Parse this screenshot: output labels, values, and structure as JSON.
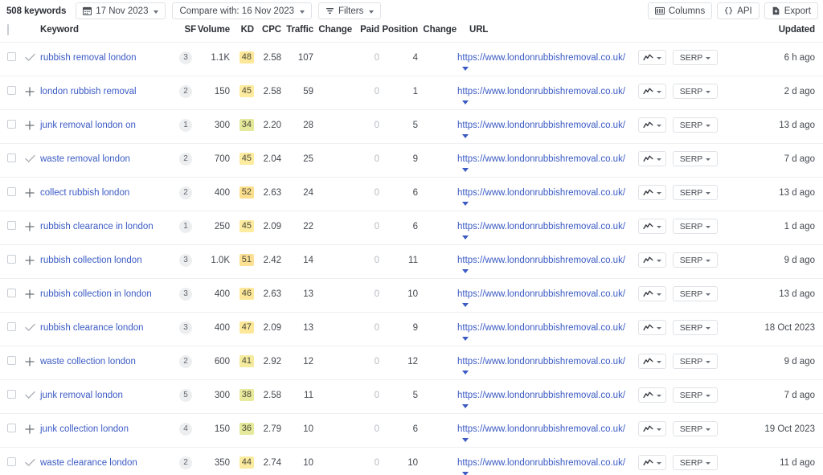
{
  "toolbar": {
    "keyword_count": "508 keywords",
    "date_button": {
      "label": "17 Nov 2023",
      "icon": "calendar-icon"
    },
    "compare_button": {
      "label": "Compare with: 16 Nov 2023"
    },
    "filters_button": {
      "label": "Filters",
      "icon": "filter-icon"
    },
    "columns_button": {
      "label": "Columns",
      "icon": "columns-icon"
    },
    "api_button": {
      "label": "API",
      "icon": "braces-icon"
    },
    "export_button": {
      "label": "Export",
      "icon": "export-icon"
    }
  },
  "table": {
    "headers": {
      "keyword": "Keyword",
      "sf": "SF",
      "volume": "Volume",
      "kd": "KD",
      "cpc": "CPC",
      "traffic": "Traffic",
      "change1": "Change",
      "paid": "Paid",
      "position": "Position",
      "change2": "Change",
      "url": "URL",
      "updated": "Updated"
    },
    "row_actions": {
      "sparkline_label": "sparkline-chart-icon",
      "serp_label": "SERP"
    },
    "rows": [
      {
        "tracked": true,
        "keyword": "rubbish removal london",
        "sf": "3",
        "volume": "1.1K",
        "kd": "48",
        "kd_color": "#fde89a",
        "cpc": "2.58",
        "traffic": "107",
        "change1": "",
        "paid": "0",
        "position": "4",
        "change2": "",
        "url": "https://www.londonrubbishremoval.co.uk/",
        "updated": "6 h ago"
      },
      {
        "tracked": false,
        "keyword": "london rubbish removal",
        "sf": "2",
        "volume": "150",
        "kd": "45",
        "kd_color": "#fdeb9f",
        "cpc": "2.58",
        "traffic": "59",
        "change1": "",
        "paid": "0",
        "position": "1",
        "change2": "",
        "url": "https://www.londonrubbishremoval.co.uk/",
        "updated": "2 d ago"
      },
      {
        "tracked": false,
        "keyword": "junk removal london on",
        "sf": "1",
        "volume": "300",
        "kd": "34",
        "kd_color": "#e3e89b",
        "cpc": "2.20",
        "traffic": "28",
        "change1": "",
        "paid": "0",
        "position": "5",
        "change2": "",
        "url": "https://www.londonrubbishremoval.co.uk/",
        "updated": "13 d ago"
      },
      {
        "tracked": true,
        "keyword": "waste removal london",
        "sf": "2",
        "volume": "700",
        "kd": "45",
        "kd_color": "#fdeb9f",
        "cpc": "2.04",
        "traffic": "25",
        "change1": "",
        "paid": "0",
        "position": "9",
        "change2": "",
        "url": "https://www.londonrubbishremoval.co.uk/",
        "updated": "7 d ago"
      },
      {
        "tracked": false,
        "keyword": "collect rubbish london",
        "sf": "2",
        "volume": "400",
        "kd": "52",
        "kd_color": "#fcdf8d",
        "cpc": "2.63",
        "traffic": "24",
        "change1": "",
        "paid": "0",
        "position": "6",
        "change2": "",
        "url": "https://www.londonrubbishremoval.co.uk/",
        "updated": "13 d ago"
      },
      {
        "tracked": false,
        "keyword": "rubbish clearance in london",
        "sf": "1",
        "volume": "250",
        "kd": "45",
        "kd_color": "#fdeb9f",
        "cpc": "2.09",
        "traffic": "22",
        "change1": "",
        "paid": "0",
        "position": "6",
        "change2": "",
        "url": "https://www.londonrubbishremoval.co.uk/",
        "updated": "1 d ago"
      },
      {
        "tracked": false,
        "keyword": "rubbish collection london",
        "sf": "3",
        "volume": "1.0K",
        "kd": "51",
        "kd_color": "#fce093",
        "cpc": "2.42",
        "traffic": "14",
        "change1": "",
        "paid": "0",
        "position": "11",
        "change2": "",
        "url": "https://www.londonrubbishremoval.co.uk/",
        "updated": "9 d ago"
      },
      {
        "tracked": false,
        "keyword": "rubbish collection in london",
        "sf": "3",
        "volume": "400",
        "kd": "46",
        "kd_color": "#fde89a",
        "cpc": "2.63",
        "traffic": "13",
        "change1": "",
        "paid": "0",
        "position": "10",
        "change2": "",
        "url": "https://www.londonrubbishremoval.co.uk/",
        "updated": "13 d ago"
      },
      {
        "tracked": true,
        "keyword": "rubbish clearance london",
        "sf": "3",
        "volume": "400",
        "kd": "47",
        "kd_color": "#fde89a",
        "cpc": "2.09",
        "traffic": "13",
        "change1": "",
        "paid": "0",
        "position": "9",
        "change2": "",
        "url": "https://www.londonrubbishremoval.co.uk/",
        "updated": "18 Oct 2023"
      },
      {
        "tracked": false,
        "keyword": "waste collection london",
        "sf": "2",
        "volume": "600",
        "kd": "41",
        "kd_color": "#f5eb9e",
        "cpc": "2.92",
        "traffic": "12",
        "change1": "",
        "paid": "0",
        "position": "12",
        "change2": "",
        "url": "https://www.londonrubbishremoval.co.uk/",
        "updated": "9 d ago"
      },
      {
        "tracked": true,
        "keyword": "junk removal london",
        "sf": "5",
        "volume": "300",
        "kd": "38",
        "kd_color": "#e9ea9c",
        "cpc": "2.58",
        "traffic": "11",
        "change1": "",
        "paid": "0",
        "position": "5",
        "change2": "",
        "url": "https://www.londonrubbishremoval.co.uk/",
        "updated": "7 d ago"
      },
      {
        "tracked": false,
        "keyword": "junk collection london",
        "sf": "4",
        "volume": "150",
        "kd": "36",
        "kd_color": "#e5e99b",
        "cpc": "2.79",
        "traffic": "10",
        "change1": "",
        "paid": "0",
        "position": "6",
        "change2": "",
        "url": "https://www.londonrubbishremoval.co.uk/",
        "updated": "19 Oct 2023"
      },
      {
        "tracked": true,
        "keyword": "waste clearance london",
        "sf": "2",
        "volume": "350",
        "kd": "44",
        "kd_color": "#fbeb9f",
        "cpc": "2.74",
        "traffic": "10",
        "change1": "",
        "paid": "0",
        "position": "10",
        "change2": "",
        "url": "https://www.londonrubbishremoval.co.uk/",
        "updated": "11 d ago"
      }
    ]
  },
  "colors": {
    "link": "#3b5bc4",
    "text": "#44484f",
    "muted": "#b6bbc1",
    "border": "#edeff1"
  }
}
